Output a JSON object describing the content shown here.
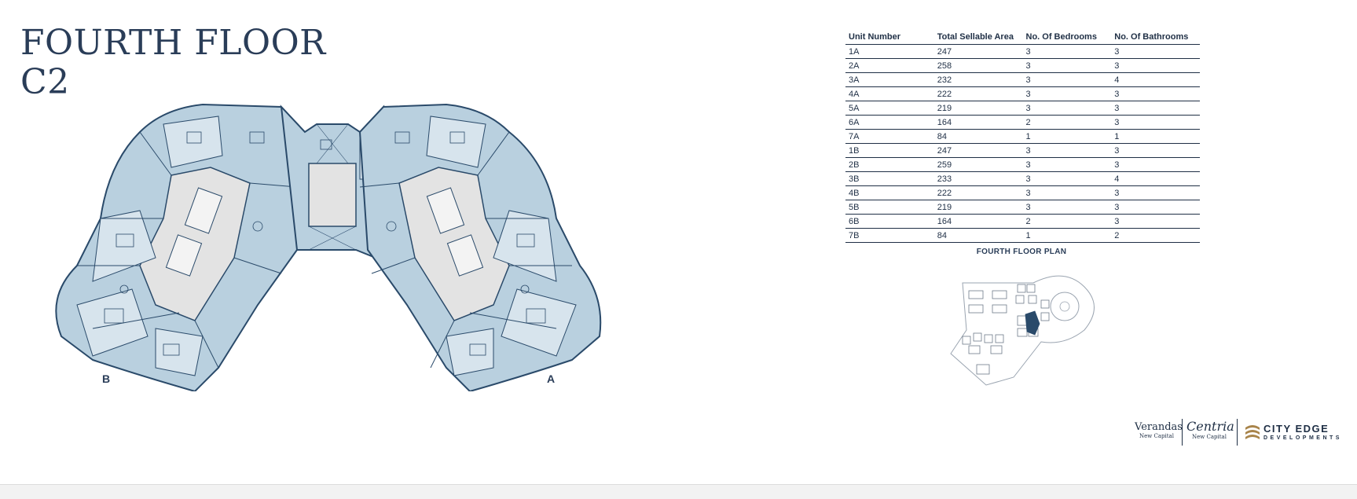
{
  "page": {
    "title_line1": "FOURTH FLOOR",
    "title_line2": "C2"
  },
  "plan": {
    "label_b": "B",
    "label_a": "A",
    "colors": {
      "unit_fill": "#b9d0df",
      "unit_fill_light": "#d7e4ed",
      "core_fill": "#e3e3e3",
      "wall": "#2a4a6a"
    }
  },
  "units_table": {
    "headers": [
      "Unit Number",
      "Total Sellable Area",
      "No. Of Bedrooms",
      "No. Of Bathrooms"
    ],
    "rows": [
      [
        "1A",
        "247",
        "3",
        "3"
      ],
      [
        "2A",
        "258",
        "3",
        "3"
      ],
      [
        "3A",
        "232",
        "3",
        "4"
      ],
      [
        "4A",
        "222",
        "3",
        "3"
      ],
      [
        "5A",
        "219",
        "3",
        "3"
      ],
      [
        "6A",
        "164",
        "2",
        "3"
      ],
      [
        "7A",
        "84",
        "1",
        "1"
      ],
      [
        "1B",
        "247",
        "3",
        "3"
      ],
      [
        "2B",
        "259",
        "3",
        "3"
      ],
      [
        "3B",
        "233",
        "3",
        "4"
      ],
      [
        "4B",
        "222",
        "3",
        "3"
      ],
      [
        "5B",
        "219",
        "3",
        "3"
      ],
      [
        "6B",
        "164",
        "2",
        "3"
      ],
      [
        "7B",
        "84",
        "1",
        "2"
      ]
    ]
  },
  "key_plan": {
    "title": "FOURTH FLOOR PLAN",
    "highlight_color": "#2a4a6a"
  },
  "logos": {
    "verandas": "Verandas",
    "verandas_sub": "New Capital",
    "centria": "Centria",
    "centria_sub": "New Capital",
    "city_edge": "CITY EDGE",
    "city_edge_sub": "DEVELOPMENTS",
    "city_edge_mark_color": "#a8844a"
  }
}
